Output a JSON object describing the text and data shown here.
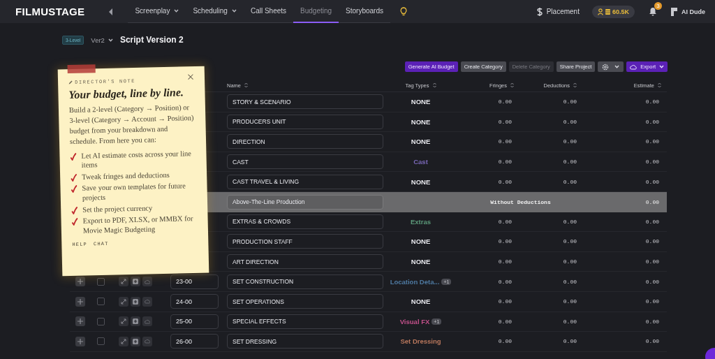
{
  "nav": {
    "logo": "FILMUSTAGE",
    "tabs": [
      {
        "label": "Screenplay",
        "dropdown": true,
        "selected": false
      },
      {
        "label": "Scheduling",
        "dropdown": true,
        "selected": false
      },
      {
        "label": "Call Sheets",
        "dropdown": false,
        "selected": false
      },
      {
        "label": "Budgeting",
        "dropdown": false,
        "selected": true
      },
      {
        "label": "Storyboards",
        "dropdown": false,
        "selected": false
      }
    ],
    "placement": "Placement",
    "credits": "60.5K",
    "notifications": "3",
    "user": "AI Dude"
  },
  "header": {
    "level_badge": "3-Level",
    "version": "Ver2",
    "title": "Script Version 2"
  },
  "toolbar": [
    {
      "kind": "primary",
      "label": "Generate AI Budget",
      "disabled": false
    },
    {
      "kind": "secondary",
      "label": "Create Category",
      "disabled": false
    },
    {
      "kind": "secondary",
      "label": "Delete Category",
      "disabled": true
    },
    {
      "kind": "secondary",
      "label": "Share Project",
      "disabled": false
    },
    {
      "kind": "settings",
      "disabled": false
    },
    {
      "kind": "export",
      "label": "Export",
      "disabled": false
    }
  ],
  "table": {
    "columns": [
      "Name",
      "Tag Types",
      "Fringes",
      "Deductions",
      "Estimate"
    ],
    "rows": [
      {
        "kind": "category",
        "name": "STORY & SCENARIO",
        "tag": {
          "text": "NONE"
        },
        "fringes": "0.00",
        "deductions": "0.00",
        "estimate": "0.00"
      },
      {
        "kind": "category",
        "name": "PRODUCERS UNIT",
        "tag": {
          "text": "NONE"
        },
        "fringes": "0.00",
        "deductions": "0.00",
        "estimate": "0.00"
      },
      {
        "kind": "category",
        "name": "DIRECTION",
        "tag": {
          "text": "NONE"
        },
        "fringes": "0.00",
        "deductions": "0.00",
        "estimate": "0.00"
      },
      {
        "kind": "category",
        "name": "CAST",
        "tag": {
          "text": "Cast",
          "color": "#7a68b8"
        },
        "fringes": "0.00",
        "deductions": "0.00",
        "estimate": "0.00"
      },
      {
        "kind": "category",
        "name": "CAST TRAVEL & LIVING",
        "tag": {
          "text": "NONE"
        },
        "fringes": "0.00",
        "deductions": "0.00",
        "estimate": "0.00"
      },
      {
        "kind": "group",
        "name": "Above-The-Line Production",
        "label": "Without Deductions",
        "estimate": "0.00"
      },
      {
        "kind": "category",
        "name": "EXTRAS & CROWDS",
        "tag": {
          "text": "Extras",
          "color": "#5c9a7a"
        },
        "fringes": "0.00",
        "deductions": "0.00",
        "estimate": "0.00"
      },
      {
        "kind": "category",
        "name": "PRODUCTION STAFF",
        "tag": {
          "text": "NONE"
        },
        "fringes": "0.00",
        "deductions": "0.00",
        "estimate": "0.00"
      },
      {
        "kind": "category",
        "name": "ART DIRECTION",
        "tag": {
          "text": "NONE"
        },
        "fringes": "0.00",
        "deductions": "0.00",
        "estimate": "0.00"
      },
      {
        "kind": "category",
        "code": "23-00",
        "checked": false,
        "name": "SET CONSTRUCTION",
        "tag": {
          "text": "Location Deta...",
          "color": "#4e7aa2",
          "extra": "+1"
        },
        "fringes": "0.00",
        "deductions": "0.00",
        "estimate": "0.00"
      },
      {
        "kind": "category",
        "code": "24-00",
        "checked": false,
        "name": "SET OPERATIONS",
        "tag": {
          "text": "NONE"
        },
        "fringes": "0.00",
        "deductions": "0.00",
        "estimate": "0.00"
      },
      {
        "kind": "category",
        "code": "25-00",
        "checked": false,
        "name": "SPECIAL EFFECTS",
        "tag": {
          "text": "Visual FX",
          "color": "#c2508a",
          "extra": "+1"
        },
        "fringes": "0.00",
        "deductions": "0.00",
        "estimate": "0.00"
      },
      {
        "kind": "category",
        "code": "26-00",
        "checked": false,
        "name": "SET DRESSING",
        "tag": {
          "text": "Set Dressing",
          "color": "#b8775c"
        },
        "fringes": "0.00",
        "deductions": "0.00",
        "estimate": "0.00"
      }
    ]
  },
  "note": {
    "label": "DIRECTOR'S NOTE",
    "title": "Your budget, line by line.",
    "body": "Build a 2-level (Category → Position) or 3-level (Category → Account → Position) budget from your breakdown and schedule. From here you can:",
    "items": [
      "Let AI estimate costs across your line items",
      "Tweak fringes and deductions",
      "Save your own templates for future projects",
      "Set the project currency",
      "Export to PDF, XLSX, or MMBX for Movie Magic Budgeting"
    ],
    "links": [
      "HELP",
      "CHAT"
    ]
  }
}
